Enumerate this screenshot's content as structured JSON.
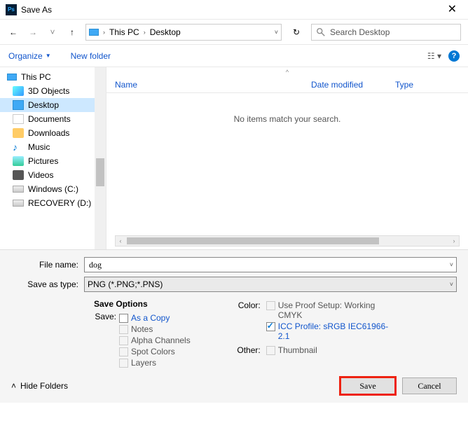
{
  "window": {
    "title": "Save As"
  },
  "nav": {
    "crumb1": "This PC",
    "crumb2": "Desktop"
  },
  "search": {
    "placeholder": "Search Desktop"
  },
  "toolbar": {
    "organize": "Organize",
    "new_folder": "New folder"
  },
  "tree": {
    "root": "This PC",
    "items": [
      "3D Objects",
      "Desktop",
      "Documents",
      "Downloads",
      "Music",
      "Pictures",
      "Videos",
      "Windows (C:)",
      "RECOVERY (D:)"
    ]
  },
  "columns": {
    "name": "Name",
    "date": "Date modified",
    "type": "Type"
  },
  "list": {
    "empty": "No items match your search."
  },
  "form": {
    "filename_label": "File name:",
    "filename_value": "dog",
    "type_label": "Save as type:",
    "type_value": "PNG (*.PNG;*.PNS)"
  },
  "options": {
    "heading": "Save Options",
    "save_label": "Save:",
    "as_copy": "As a Copy",
    "notes": "Notes",
    "alpha": "Alpha Channels",
    "spot": "Spot Colors",
    "layers": "Layers",
    "color_label": "Color:",
    "proof": "Use Proof Setup: Working CMYK",
    "icc": "ICC Profile:  sRGB IEC61966-2.1",
    "other_label": "Other:",
    "thumb": "Thumbnail"
  },
  "footer": {
    "hide": "Hide Folders",
    "save": "Save",
    "cancel": "Cancel"
  }
}
